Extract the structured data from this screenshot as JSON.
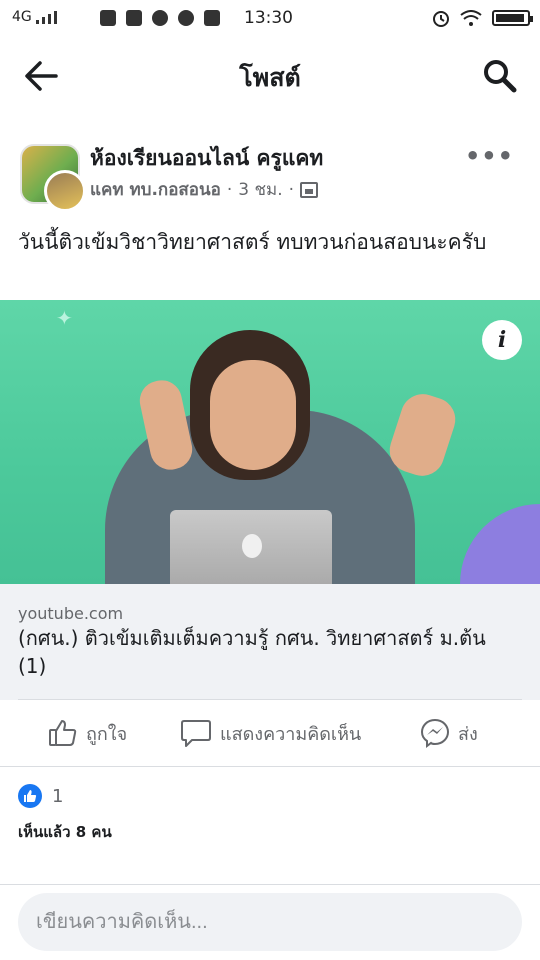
{
  "status_bar": {
    "network": "4G",
    "time": "13:30"
  },
  "header": {
    "title": "โพสต์"
  },
  "post": {
    "group_name": "ห้องเรียนออนไลน์ ครูแคท",
    "author": "แคท ทบ.กอสอนอ",
    "time_ago": "3 ชม.",
    "separator": "·",
    "text": "วันนี้ติวเข้มวิชาวิทยาศาสตร์ ทบทวนก่อนสอบนะครับ",
    "more_label": "•••"
  },
  "link_preview": {
    "domain": "youtube.com",
    "title": "(กศน.) ติวเข้มเติมเต็มความรู้ กศน. วิทยาศาสตร์ ม.ต้น (1)",
    "info_label": "i"
  },
  "actions": {
    "like_label": "ถูกใจ",
    "comment_label": "แสดงความคิดเห็น",
    "share_label": "ส่ง"
  },
  "reactions": {
    "like_count": "1",
    "seen_by": "เห็นแล้ว 8 คน"
  },
  "comment_box": {
    "placeholder": "เขียนความคิดเห็น..."
  },
  "colors": {
    "accent": "#1877f2",
    "muted": "#65676b",
    "preview_bg": "#f0f2f5"
  }
}
